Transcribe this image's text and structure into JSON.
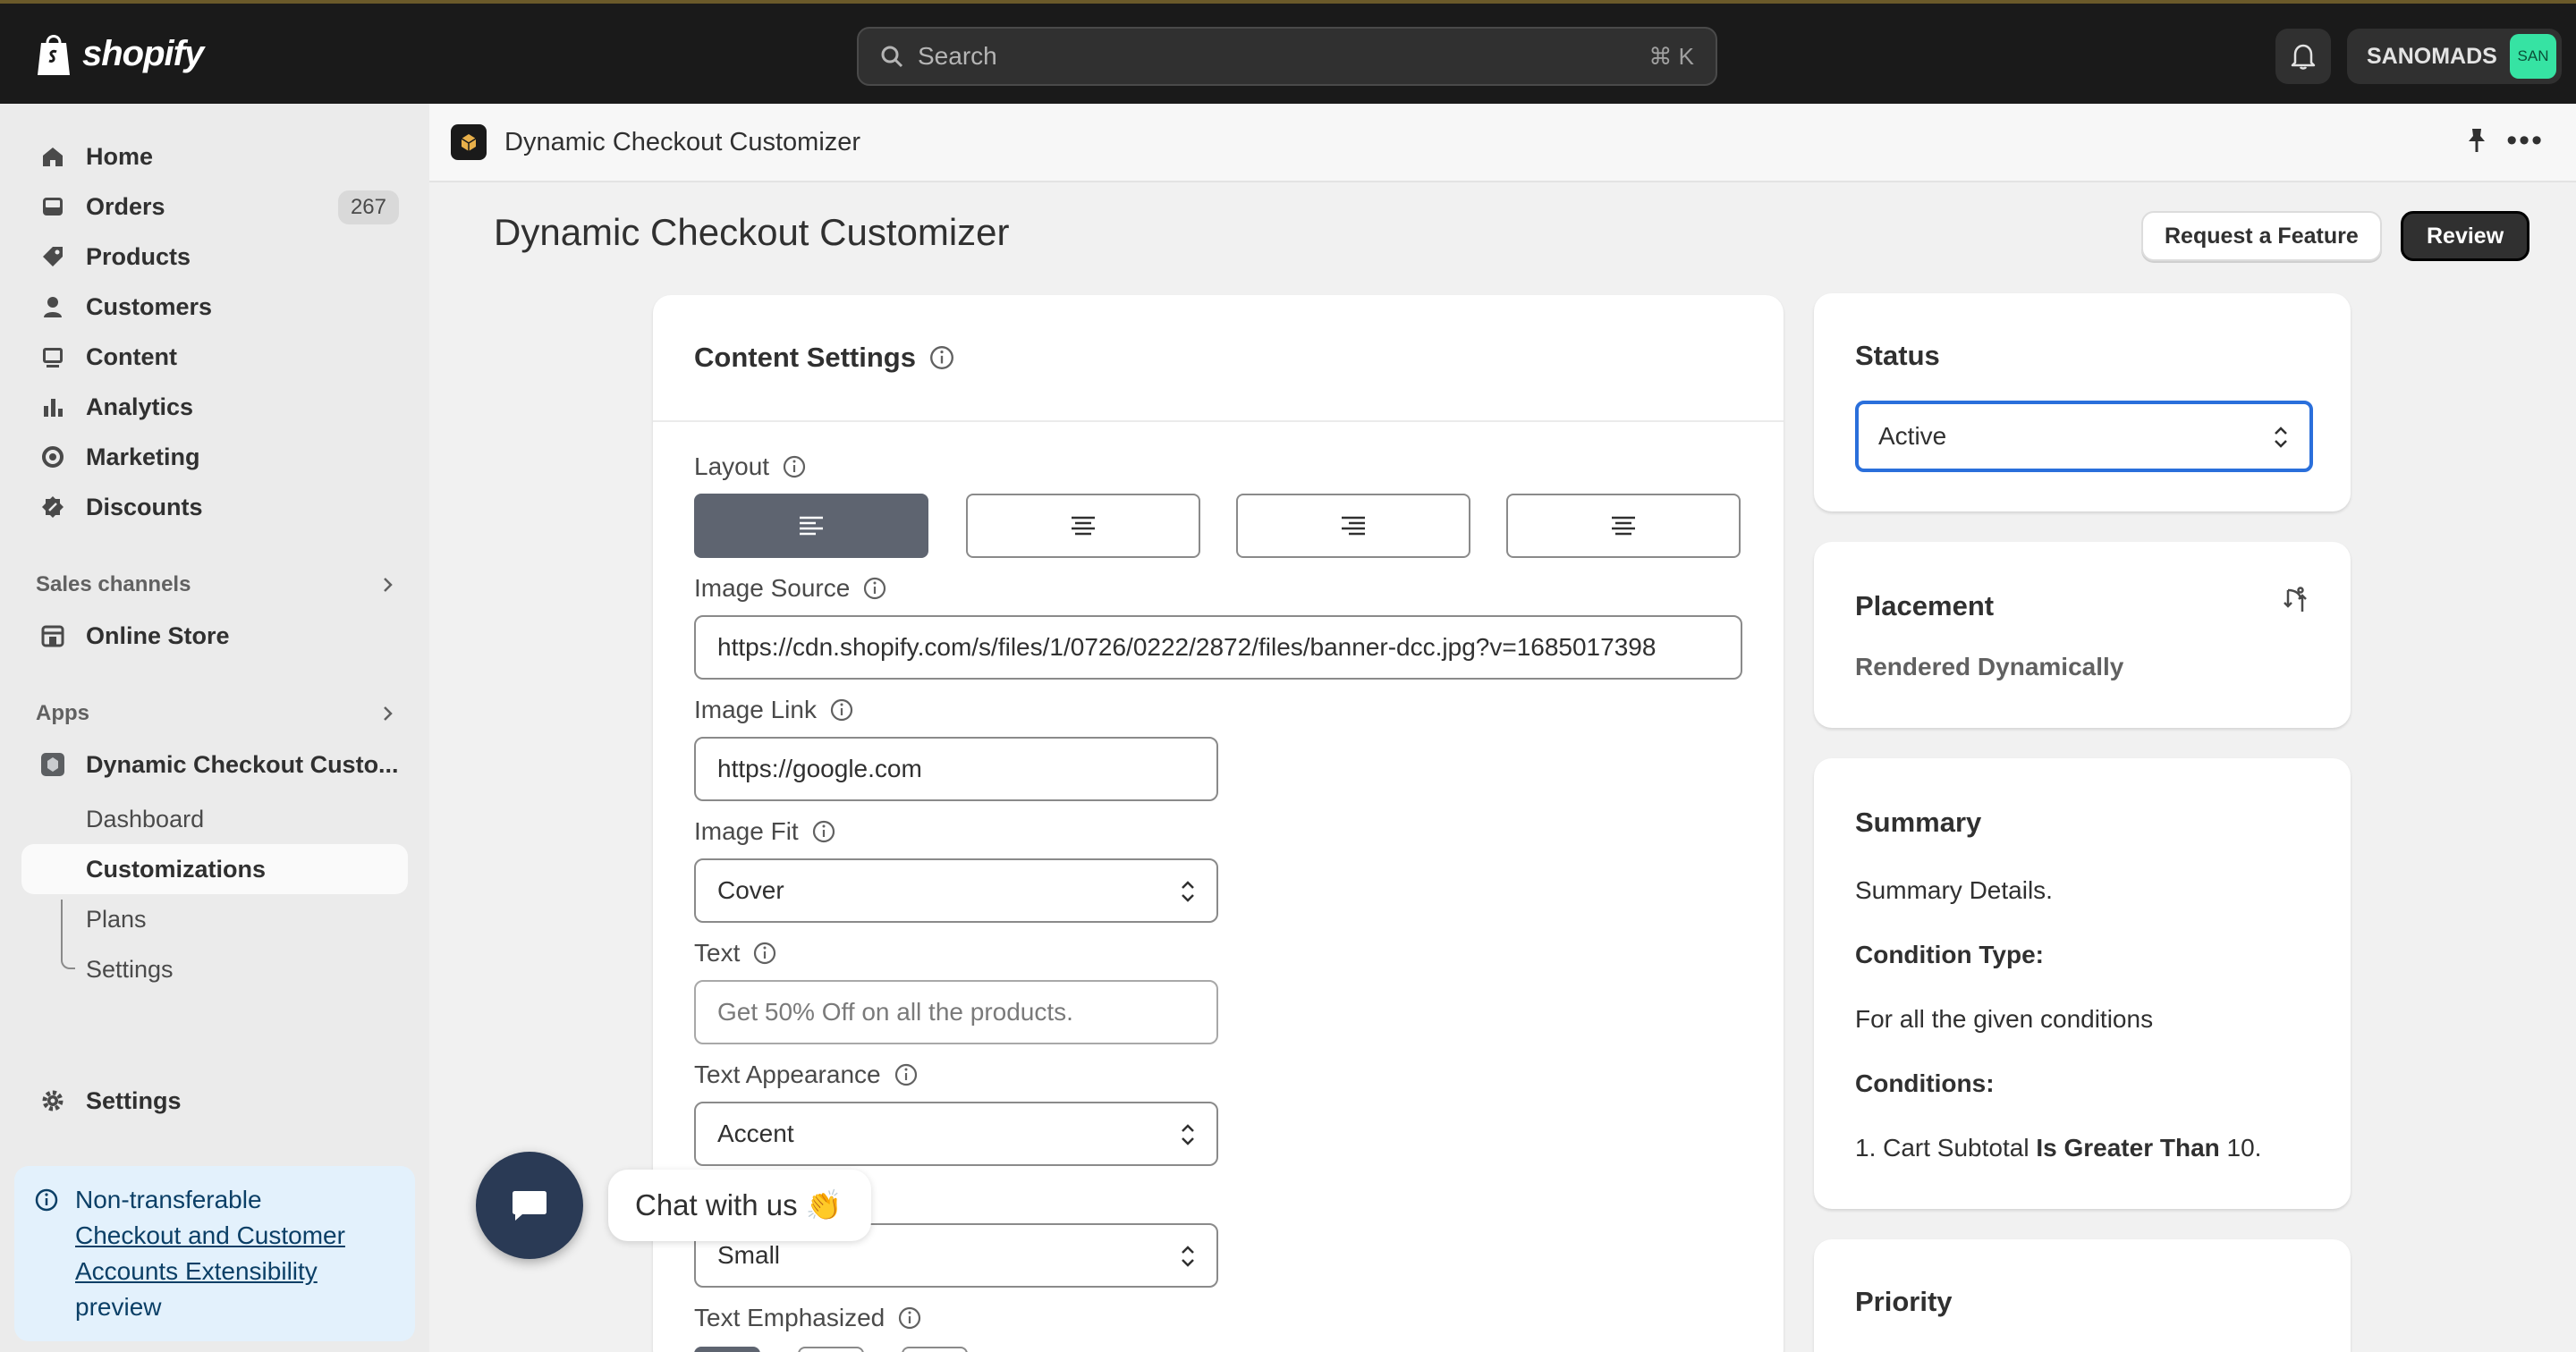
{
  "topbar": {
    "brand": "shopify",
    "search_placeholder": "Search",
    "search_shortcut": "⌘ K",
    "store_name": "SANOMADS",
    "avatar_text": "SAN"
  },
  "sidebar": {
    "items": [
      {
        "label": "Home",
        "icon": "home-icon"
      },
      {
        "label": "Orders",
        "icon": "orders-icon",
        "count": "267"
      },
      {
        "label": "Products",
        "icon": "tag-icon"
      },
      {
        "label": "Customers",
        "icon": "person-icon"
      },
      {
        "label": "Content",
        "icon": "content-icon"
      },
      {
        "label": "Analytics",
        "icon": "bar-chart-icon"
      },
      {
        "label": "Marketing",
        "icon": "target-icon"
      },
      {
        "label": "Discounts",
        "icon": "discount-icon"
      }
    ],
    "sales_channels_heading": "Sales channels",
    "online_store": "Online Store",
    "apps_heading": "Apps",
    "app_name": "Dynamic Checkout Custo...",
    "app_subitems": [
      "Dashboard",
      "Customizations",
      "Plans",
      "Settings"
    ],
    "settings": "Settings",
    "notice": {
      "prefix": "Non-transferable",
      "link": "Checkout and Customer Accounts Extensibility",
      "suffix": "preview"
    }
  },
  "header": {
    "app_title": "Dynamic Checkout Customizer",
    "page_title": "Dynamic Checkout Customizer",
    "request_feature": "Request a Feature",
    "review": "Review"
  },
  "content_settings": {
    "title": "Content Settings",
    "layout_label": "Layout",
    "image_source_label": "Image Source",
    "image_source_value": "https://cdn.shopify.com/s/files/1/0726/0222/2872/files/banner-dcc.jpg?v=1685017398",
    "image_link_label": "Image Link",
    "image_link_value": "https://google.com",
    "image_fit_label": "Image Fit",
    "image_fit_value": "Cover",
    "text_label": "Text",
    "text_placeholder": "Get 50% Off on all the products.",
    "text_appearance_label": "Text Appearance",
    "text_appearance_value": "Accent",
    "text_size_value": "Small",
    "text_emphasized_label": "Text Emphasized"
  },
  "status": {
    "title": "Status",
    "value": "Active"
  },
  "placement": {
    "title": "Placement",
    "value": "Rendered Dynamically"
  },
  "summary": {
    "title": "Summary",
    "details": "Summary Details.",
    "condition_type_label": "Condition Type:",
    "condition_type_value": "For all the given conditions",
    "conditions_label": "Conditions:",
    "condition_prefix": "1. Cart Subtotal",
    "condition_operator": "Is Greater Than",
    "condition_value": "10."
  },
  "priority": {
    "title": "Priority"
  },
  "chat": {
    "label": "Chat with us 👏"
  }
}
